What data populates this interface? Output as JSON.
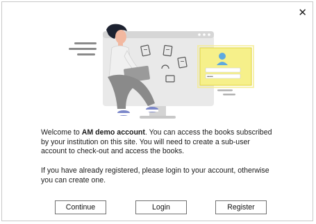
{
  "dialog": {
    "close_glyph": "✕",
    "welcome_prefix": "Welcome to ",
    "account_name": "AM demo account",
    "welcome_rest": ". You can access the books subscribed by your institution on this site. You will need to create a sub-user account to check-out and access the books.",
    "info_text": "If you have already registered, please login to your account, otherwise you can create one.",
    "illustration_password_mask": "•••••"
  },
  "buttons": {
    "continue_label": "Continue",
    "login_label": "Login",
    "register_label": "Register"
  },
  "colors": {
    "login_card": "#f6f08a",
    "login_card_border": "#e4d84a",
    "avatar": "#5ea9e0",
    "screen": "#e9e9e9",
    "person_pants": "#8a8a8a",
    "person_shirt": "#f0f0f0",
    "shoes": "#7a86c9"
  }
}
